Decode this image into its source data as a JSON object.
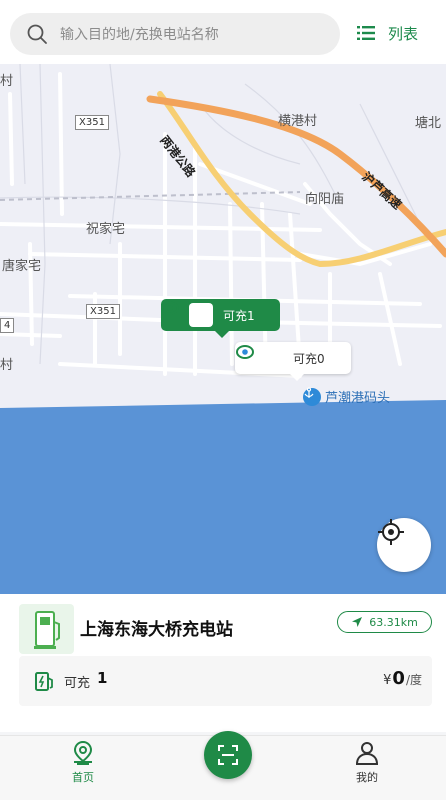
{
  "search": {
    "placeholder": "输入目的地/充换电站名称"
  },
  "list_toggle": {
    "label": "列表"
  },
  "map": {
    "places": {
      "cun_left": "村",
      "cun_left_lower": "村",
      "henggang_cun": "横港村",
      "tang_bei": "塘北",
      "xiangyang_miao": "向阳庙",
      "zhu_jia_zhai": "祝家宅",
      "tang_jia_zhai": "唐家宅",
      "harbor": "芦潮港码头"
    },
    "roads": {
      "x351_top": "X351",
      "x351_mid": "X351",
      "num_4": "4",
      "chengnan_road": "两港公路",
      "hulu_expressway": "沪芦高速"
    },
    "markers": [
      {
        "label": "可充1",
        "state": "selected"
      },
      {
        "label": "可充0",
        "state": "idle"
      }
    ]
  },
  "station": {
    "name": "上海东海大桥充电站",
    "distance": "63.31km",
    "available_label": "可充",
    "available_count": "1",
    "price_currency": "¥",
    "price_value": "0",
    "price_unit": "/度"
  },
  "tabbar": {
    "home_label": "首页",
    "mine_label": "我的"
  },
  "colors": {
    "accent": "#1f8a47",
    "sea": "#5a93d6",
    "map_bg": "#eeeff6",
    "highway": "#f2a35a"
  }
}
